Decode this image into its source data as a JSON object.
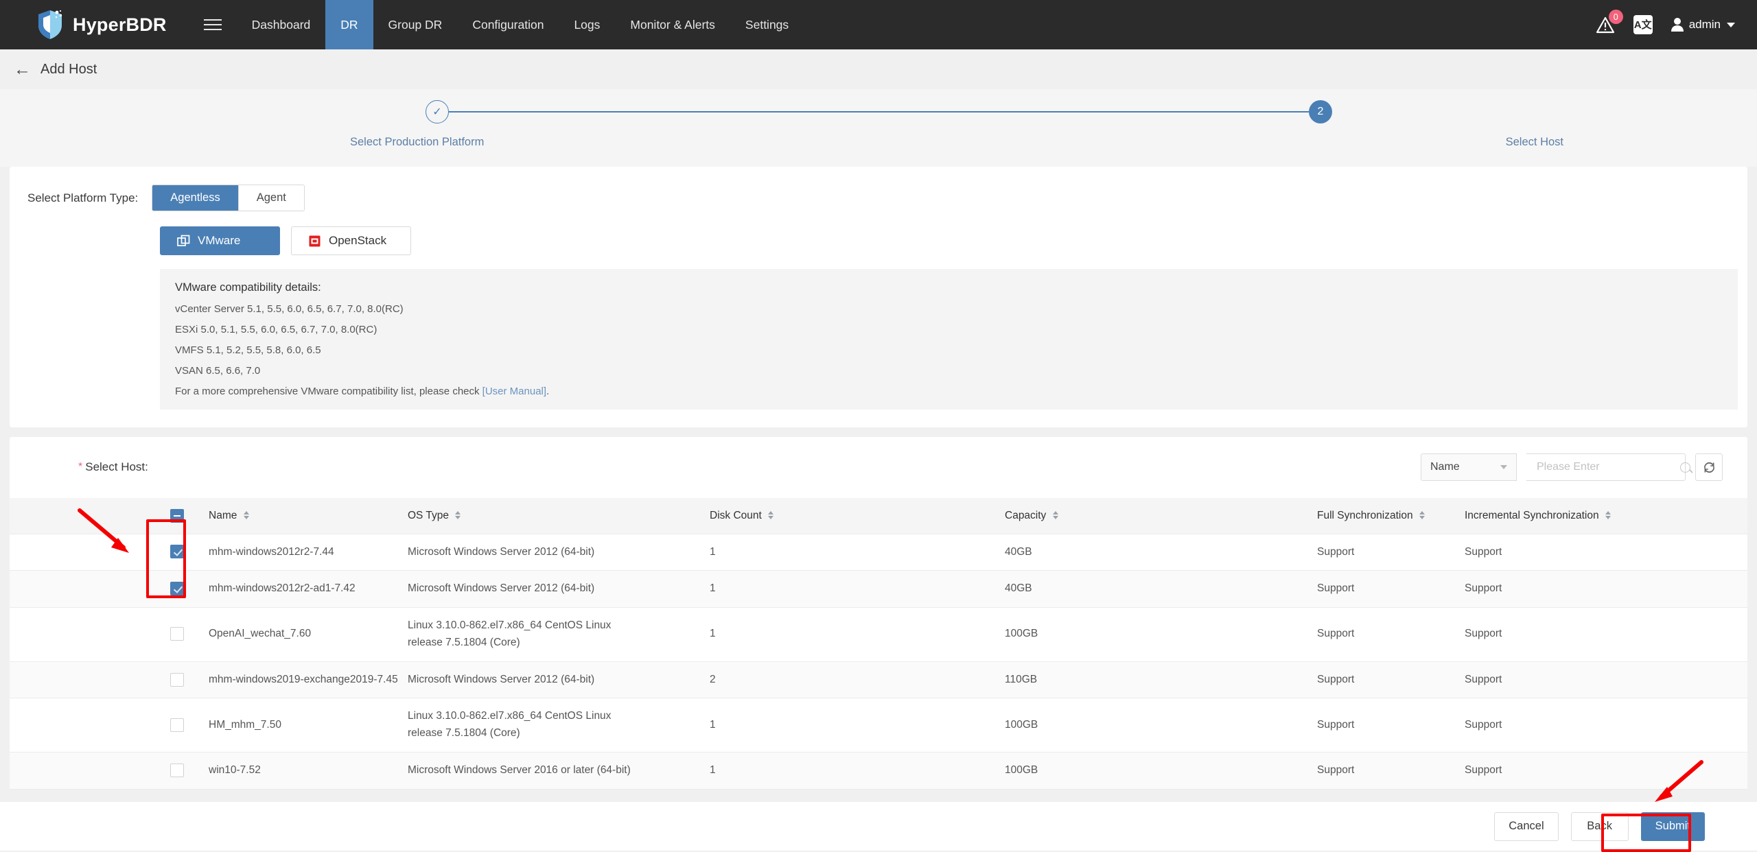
{
  "topbar": {
    "brand": "HyperBDR",
    "menu_icon": "hamburger-icon",
    "nav": [
      {
        "label": "Dashboard",
        "active": false
      },
      {
        "label": "DR",
        "active": true
      },
      {
        "label": "Group DR",
        "active": false
      },
      {
        "label": "Configuration",
        "active": false
      },
      {
        "label": "Logs",
        "active": false
      },
      {
        "label": "Monitor & Alerts",
        "active": false
      },
      {
        "label": "Settings",
        "active": false
      }
    ],
    "alert_badge": "0",
    "lang_label": "A文",
    "user": "admin",
    "accent": "#4a7fb5",
    "bg": "#2b2b2b"
  },
  "page": {
    "back_arrow": "←",
    "title": "Add Host"
  },
  "steps": [
    {
      "label": "Select Production Platform",
      "marker": "✓",
      "state": "done"
    },
    {
      "label": "Select Host",
      "marker": "2",
      "state": "current"
    }
  ],
  "platform": {
    "type_label": "Select Platform Type:",
    "types": [
      {
        "label": "Agentless",
        "selected": true
      },
      {
        "label": "Agent",
        "selected": false
      }
    ],
    "platforms": [
      {
        "label": "VMware",
        "icon": "vmware-icon",
        "selected": true
      },
      {
        "label": "OpenStack",
        "icon": "openstack-icon",
        "selected": false
      }
    ],
    "compat": {
      "title": "VMware compatibility details:",
      "lines": [
        "vCenter Server 5.1, 5.5, 6.0, 6.5, 6.7, 7.0, 8.0(RC)",
        "ESXi 5.0, 5.1, 5.5, 6.0, 6.5, 6.7, 7.0, 8.0(RC)",
        "VMFS 5.1, 5.2, 5.5, 5.8, 6.0, 6.5",
        "VSAN 6.5, 6.6, 7.0"
      ],
      "footer_prefix": "For a more comprehensive VMware compatibility list, please check ",
      "footer_link": "[User Manual]",
      "footer_suffix": "."
    }
  },
  "host": {
    "label": "Select Host:",
    "required_mark": "*",
    "search": {
      "field": "Name",
      "value": "",
      "placeholder": "Please Enter",
      "search_icon": "search-icon",
      "refresh_icon": "refresh-icon"
    },
    "columns": [
      {
        "key": "name",
        "label": "Name",
        "sortable": true
      },
      {
        "key": "os",
        "label": "OS Type",
        "sortable": true
      },
      {
        "key": "disk",
        "label": "Disk Count",
        "sortable": true
      },
      {
        "key": "cap",
        "label": "Capacity",
        "sortable": true
      },
      {
        "key": "full",
        "label": "Full Synchronization",
        "sortable": true
      },
      {
        "key": "inc",
        "label": "Incremental Synchronization",
        "sortable": true
      }
    ],
    "header_checkbox_state": "indeterminate",
    "rows": [
      {
        "checked": true,
        "name": "mhm-windows2012r2-7.44",
        "os": "Microsoft Windows Server 2012 (64-bit)",
        "disk": "1",
        "cap": "40GB",
        "full": "Support",
        "inc": "Support"
      },
      {
        "checked": true,
        "name": "mhm-windows2012r2-ad1-7.42",
        "os": "Microsoft Windows Server 2012 (64-bit)",
        "disk": "1",
        "cap": "40GB",
        "full": "Support",
        "inc": "Support"
      },
      {
        "checked": false,
        "name": "OpenAI_wechat_7.60",
        "os": "Linux 3.10.0-862.el7.x86_64 CentOS Linux release 7.5.1804 (Core)",
        "disk": "1",
        "cap": "100GB",
        "full": "Support",
        "inc": "Support"
      },
      {
        "checked": false,
        "name": "mhm-windows2019-exchange2019-7.45",
        "os": "Microsoft Windows Server 2012 (64-bit)",
        "disk": "2",
        "cap": "110GB",
        "full": "Support",
        "inc": "Support"
      },
      {
        "checked": false,
        "name": "HM_mhm_7.50",
        "os": "Linux 3.10.0-862.el7.x86_64 CentOS Linux release 7.5.1804 (Core)",
        "disk": "1",
        "cap": "100GB",
        "full": "Support",
        "inc": "Support"
      },
      {
        "checked": false,
        "name": "win10-7.52",
        "os": "Microsoft Windows Server 2016 or later (64-bit)",
        "disk": "1",
        "cap": "100GB",
        "full": "Support",
        "inc": "Support"
      }
    ]
  },
  "footer": {
    "cancel": "Cancel",
    "back": "Back",
    "submit": "Submit"
  },
  "annotations": {
    "color": "#f50000",
    "items": [
      "arrow-to-checkboxes",
      "box-around-checkboxes",
      "arrow-to-submit",
      "box-around-submit"
    ]
  }
}
